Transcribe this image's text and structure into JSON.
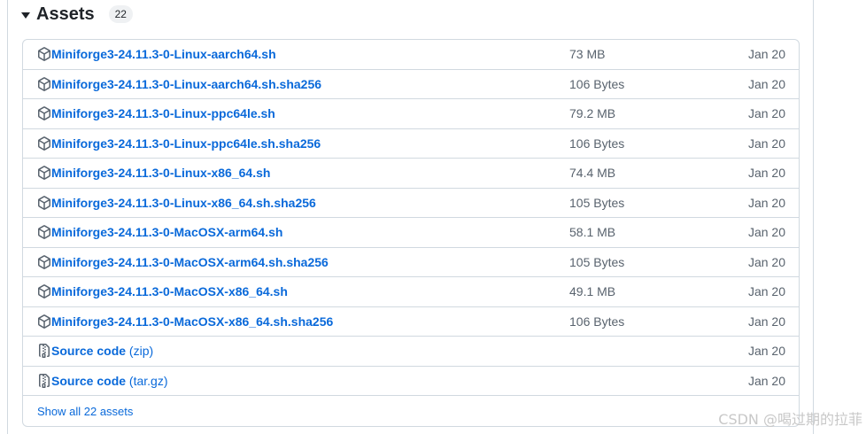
{
  "header": {
    "title": "Assets",
    "count": "22"
  },
  "assets": [
    {
      "icon": "package-icon",
      "name": "Miniforge3-24.11.3-0-Linux-aarch64.sh",
      "suffix": "",
      "size": "73 MB",
      "date": "Jan 20"
    },
    {
      "icon": "package-icon",
      "name": "Miniforge3-24.11.3-0-Linux-aarch64.sh.sha256",
      "suffix": "",
      "size": "106 Bytes",
      "date": "Jan 20"
    },
    {
      "icon": "package-icon",
      "name": "Miniforge3-24.11.3-0-Linux-ppc64le.sh",
      "suffix": "",
      "size": "79.2 MB",
      "date": "Jan 20"
    },
    {
      "icon": "package-icon",
      "name": "Miniforge3-24.11.3-0-Linux-ppc64le.sh.sha256",
      "suffix": "",
      "size": "106 Bytes",
      "date": "Jan 20"
    },
    {
      "icon": "package-icon",
      "name": "Miniforge3-24.11.3-0-Linux-x86_64.sh",
      "suffix": "",
      "size": "74.4 MB",
      "date": "Jan 20"
    },
    {
      "icon": "package-icon",
      "name": "Miniforge3-24.11.3-0-Linux-x86_64.sh.sha256",
      "suffix": "",
      "size": "105 Bytes",
      "date": "Jan 20"
    },
    {
      "icon": "package-icon",
      "name": "Miniforge3-24.11.3-0-MacOSX-arm64.sh",
      "suffix": "",
      "size": "58.1 MB",
      "date": "Jan 20"
    },
    {
      "icon": "package-icon",
      "name": "Miniforge3-24.11.3-0-MacOSX-arm64.sh.sha256",
      "suffix": "",
      "size": "105 Bytes",
      "date": "Jan 20"
    },
    {
      "icon": "package-icon",
      "name": "Miniforge3-24.11.3-0-MacOSX-x86_64.sh",
      "suffix": "",
      "size": "49.1 MB",
      "date": "Jan 20"
    },
    {
      "icon": "package-icon",
      "name": "Miniforge3-24.11.3-0-MacOSX-x86_64.sh.sha256",
      "suffix": "",
      "size": "106 Bytes",
      "date": "Jan 20"
    },
    {
      "icon": "file-zip-icon",
      "name": "Source code",
      "suffix": " (zip)",
      "size": "",
      "date": "Jan 20"
    },
    {
      "icon": "file-zip-icon",
      "name": "Source code",
      "suffix": " (tar.gz)",
      "size": "",
      "date": "Jan 20"
    }
  ],
  "footer": {
    "show_all": "Show all 22 assets"
  },
  "watermark": "CSDN @喝过期的拉菲"
}
